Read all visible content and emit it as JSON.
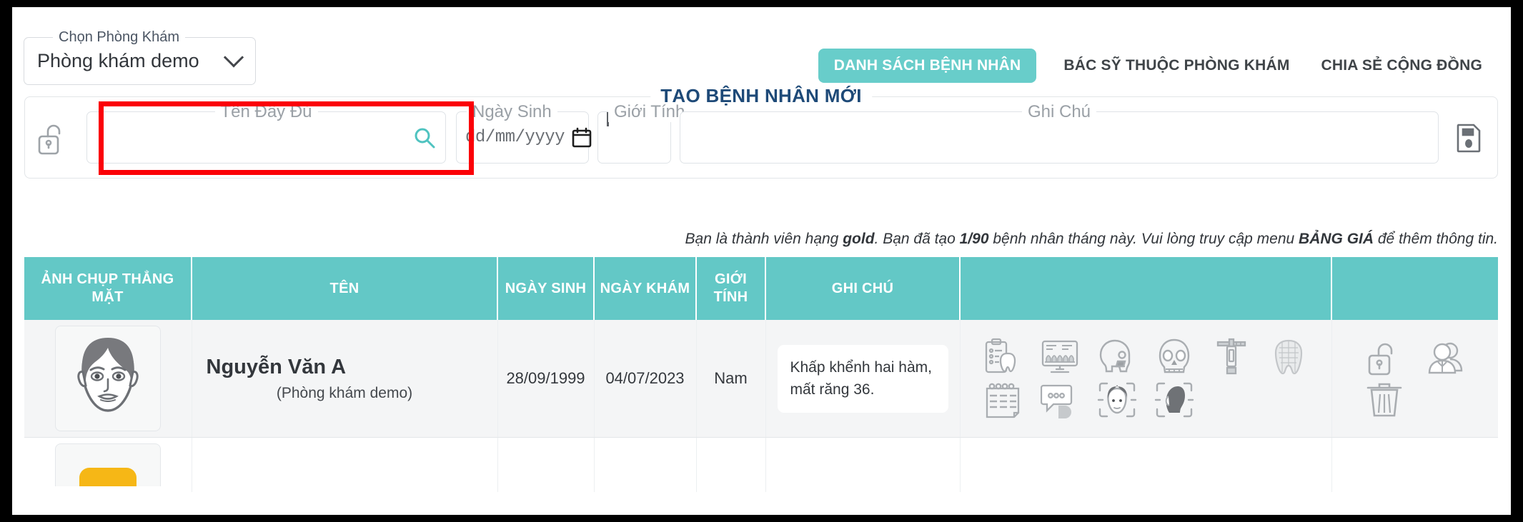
{
  "clinic_selector": {
    "legend": "Chọn Phòng Khám",
    "value": "Phòng khám demo",
    "chevron_icon": "chevron-down-icon"
  },
  "topnav": {
    "items": [
      {
        "label": "DANH SÁCH BỆNH NHÂN",
        "active": true
      },
      {
        "label": "BÁC SỸ THUỘC PHÒNG KHÁM",
        "active": false
      },
      {
        "label": "CHIA SẺ CỘNG ĐỒNG",
        "active": false
      }
    ],
    "active_bg": "#68cdca"
  },
  "create_patient": {
    "title": "TẠO BỆNH NHÂN MỚI",
    "title_color": "#1e4a78",
    "lock_icon": "unlock-icon",
    "fields": {
      "full_name": {
        "legend": "Tên Đầy Đủ",
        "value": "",
        "placeholder": "",
        "search_icon": "search-icon",
        "highlight_color": "#fb0007"
      },
      "dob": {
        "legend": "Ngày Sinh",
        "value": "dd/mm/yyyy",
        "calendar_icon": "calendar-icon"
      },
      "gender": {
        "legend": "Giới Tính",
        "value": "",
        "chevron_icon": "chevron-down-icon"
      },
      "note": {
        "legend": "Ghi Chú",
        "value": "",
        "placeholder": ""
      }
    },
    "save_icon": "save-floppy-icon"
  },
  "quota_notice": {
    "part1": "Bạn là thành viên hạng ",
    "tier": "gold",
    "part2": ". Bạn đã tạo ",
    "count": "1/90",
    "part3": " bệnh nhân tháng này.  Vui lòng truy cập menu ",
    "menu": "BẢNG GIÁ",
    "part4": " để thêm thông tin."
  },
  "table": {
    "header_bg": "#63c8c6",
    "columns": [
      "ẢNH CHỤP THẲNG MẶT",
      "TÊN",
      "NGÀY SINH",
      "NGÀY KHÁM",
      "GIỚI TÍNH",
      "GHI CHÚ",
      "",
      ""
    ],
    "rows": [
      {
        "photo_icon": "patient-avatar-face",
        "name": "Nguyễn Văn A",
        "clinic": "(Phòng khám demo)",
        "dob": "28/09/1999",
        "exam_date": "04/07/2023",
        "gender": "Nam",
        "note": "Khấp khểnh hai hàm, mất răng 36.",
        "tool_icons": [
          "dental-chart-clipboard-icon",
          "xray-monitor-icon",
          "skull-lateral-icon",
          "skull-frontal-icon",
          "caliper-icon",
          "tooth-3d-icon",
          "calendar-icon",
          "chat-bubbles-icon",
          "face-front-scan-icon",
          "face-profile-scan-icon"
        ],
        "action_icons": [
          "unlock-icon",
          "share-users-icon",
          "trash-icon"
        ]
      }
    ]
  }
}
